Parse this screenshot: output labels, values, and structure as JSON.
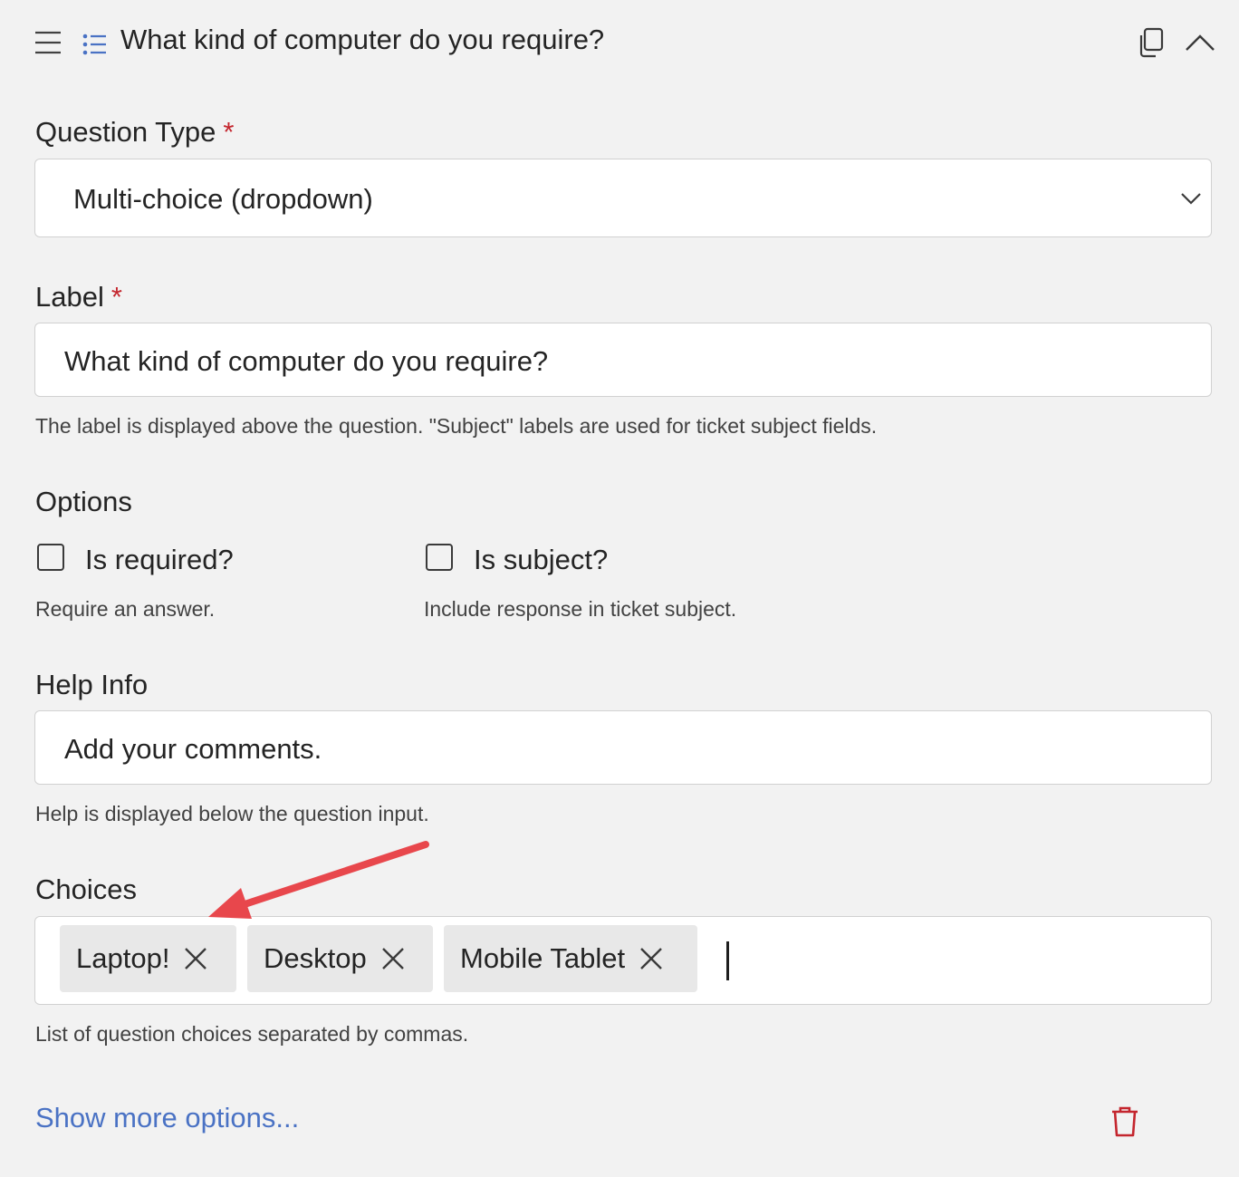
{
  "header": {
    "title": "What kind of computer do you require?"
  },
  "question_type": {
    "label": "Question Type",
    "required_mark": "*",
    "value": "Multi-choice (dropdown)"
  },
  "label_field": {
    "label": "Label",
    "required_mark": "*",
    "value": "What kind of computer do you require?",
    "hint": "The label is displayed above the question. \"Subject\" labels are used for ticket subject fields."
  },
  "options": {
    "heading": "Options",
    "is_required": {
      "label": "Is required?",
      "hint": "Require an answer.",
      "checked": false
    },
    "is_subject": {
      "label": "Is subject?",
      "hint": "Include response in ticket subject.",
      "checked": false
    }
  },
  "help_info": {
    "label": "Help Info",
    "value": "Add your comments.",
    "hint": "Help is displayed below the question input."
  },
  "choices": {
    "label": "Choices",
    "items": [
      "Laptop!",
      "Desktop",
      "Mobile Tablet"
    ],
    "hint": "List of question choices separated by commas."
  },
  "footer": {
    "show_more": "Show more options..."
  },
  "colors": {
    "accent": "#4a72c4",
    "required": "#c4262e",
    "delete": "#c4262e",
    "annotation_arrow": "#e8474c"
  },
  "icons": [
    "hamburger-icon",
    "list-icon",
    "copy-icon",
    "chevron-up-icon",
    "chevron-down-icon",
    "close-icon",
    "trash-icon",
    "annotation-arrow"
  ]
}
